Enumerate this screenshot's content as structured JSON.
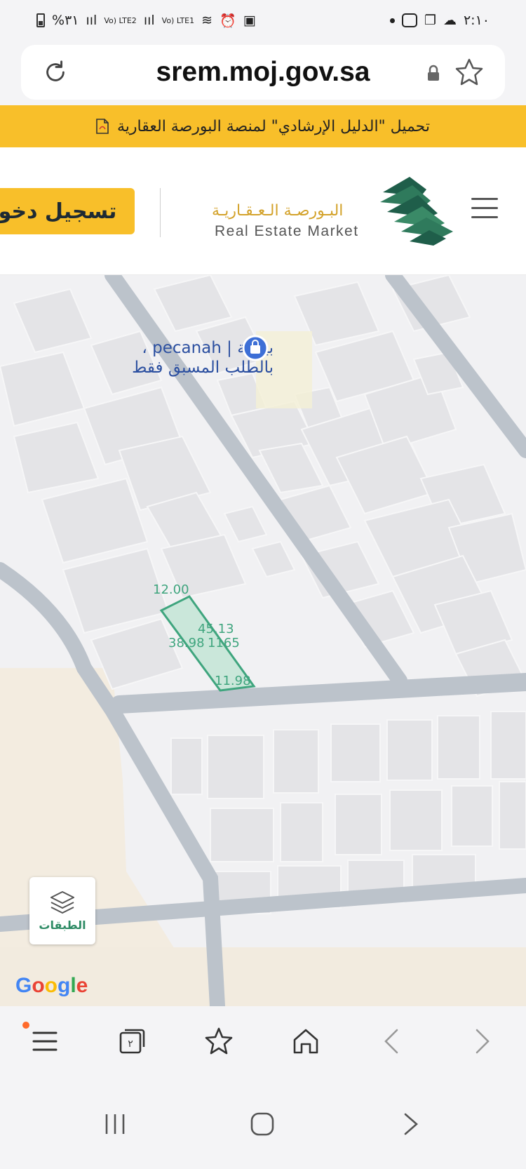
{
  "status_bar": {
    "time": "٢:١٠",
    "battery": "%٣١",
    "sim2": "Vo) LTE2",
    "sim1": "Vo) LTE1"
  },
  "browser": {
    "url": "srem.moj.gov.sa"
  },
  "banner": {
    "text": "تحميل \"الدليل الإرشادي\" لمنصة البورصة العقارية"
  },
  "header": {
    "login_label": "تسجيل دخول",
    "brand_ar": "البـورصـة الـعـقـاريـة",
    "brand_en": "Real Estate Market"
  },
  "map": {
    "poi_line1": "بيكانة | pecanah ،",
    "poi_line2": "بالطلب المسبق فقط",
    "parcel": {
      "top_length": "12.00",
      "side_length": "45.13",
      "left_length": "38.98",
      "parcel_number": "1165",
      "bottom_length": "11.98"
    },
    "layers_label": "الطبقات",
    "attribution": "Google"
  },
  "colors": {
    "accent": "#f8bf2a",
    "parcel": "#3fa57e",
    "map_bg": "#f1f1f3",
    "road": "#bcc3cb"
  },
  "toolbar": {
    "tabs_count": "٢"
  }
}
